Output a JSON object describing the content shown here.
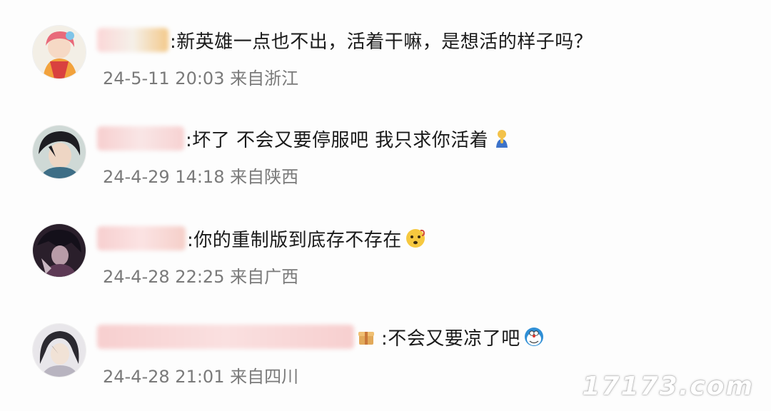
{
  "comments": [
    {
      "text": ":新英雄一点也不出，活着干嘛，是想活的样子吗？",
      "timestamp": "24-5-11 20:03 来自浙江",
      "avatar_icon": "anime-girl-avatar-icon",
      "emoji": ""
    },
    {
      "text": ":坏了 不会又要停服吧 我只求你活着",
      "timestamp": "24-4-29 14:18 来自陕西",
      "avatar_icon": "dark-hair-character-avatar-icon",
      "emoji": "praying-figure-emoji-icon"
    },
    {
      "text": ":你的重制版到底存不存在",
      "timestamp": "24-4-28 22:25 来自广西",
      "avatar_icon": "dark-character-avatar-icon",
      "emoji": "confused-face-emoji-icon"
    },
    {
      "text": ":不会又要凉了吧",
      "timestamp": "24-4-28 21:01 来自四川",
      "avatar_icon": "hooded-character-avatar-icon",
      "emoji": "doraemon-emoji-icon"
    }
  ],
  "watermark": "17173.com",
  "colors": {
    "text": "#1a1a1a",
    "timestamp": "#7a7a7a",
    "blur_pink": "#f6c9c9"
  }
}
